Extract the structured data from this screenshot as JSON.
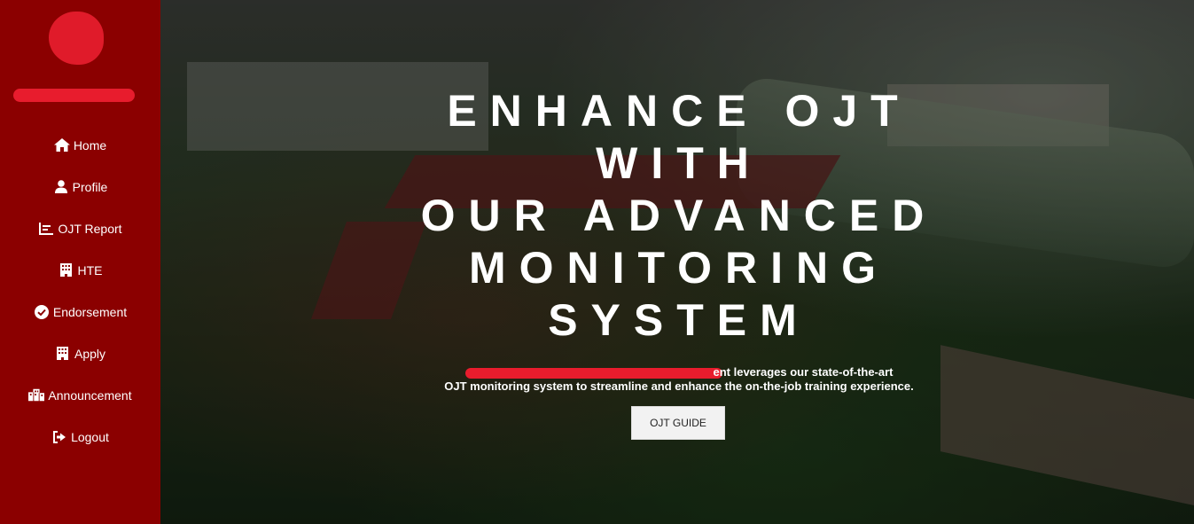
{
  "colors": {
    "sidebar_bg": "#8b0000",
    "redaction": "#e81c2d",
    "button_bg": "#f2f2f2"
  },
  "sidebar": {
    "items": [
      {
        "label": "Home",
        "icon": "home-icon"
      },
      {
        "label": "Profile",
        "icon": "user-icon"
      },
      {
        "label": "OJT Report",
        "icon": "report-icon"
      },
      {
        "label": "HTE",
        "icon": "building-icon"
      },
      {
        "label": "Endorsement",
        "icon": "check-circle-icon"
      },
      {
        "label": "Apply",
        "icon": "building-icon"
      },
      {
        "label": "Announcement",
        "icon": "buildings-icon"
      },
      {
        "label": "Logout",
        "icon": "logout-icon"
      }
    ]
  },
  "hero": {
    "headline_lines": [
      "ENHANCE OJT",
      "WITH",
      "OUR ADVANCED",
      "MONITORING",
      "SYSTEM"
    ],
    "tagline_line1_visible": "ent leverages our state-of-the-art",
    "tagline_line2": "OJT monitoring system to streamline and enhance the on-the-job training experience.",
    "button_label": "OJT GUIDE"
  }
}
